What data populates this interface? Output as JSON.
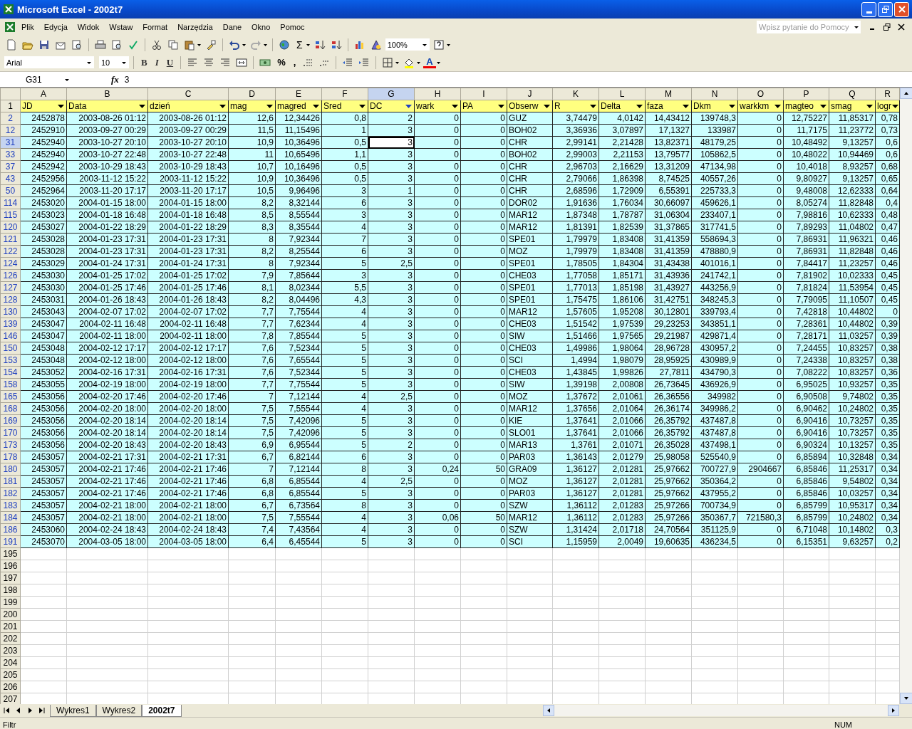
{
  "window": {
    "title": "Microsoft Excel - 2002t7"
  },
  "menu": [
    "Plik",
    "Edycja",
    "Widok",
    "Wstaw",
    "Format",
    "Narzędzia",
    "Dane",
    "Okno",
    "Pomoc"
  ],
  "help_box": {
    "placeholder": "Wpisz pytanie do Pomocy"
  },
  "toolbar": {
    "sum": "Σ",
    "zoom": "100%",
    "font": "Arial",
    "font_size": "10",
    "format_buttons": [
      "B",
      "I",
      "U"
    ],
    "percent": "%",
    "comma": ",",
    "font_color_letter": "A"
  },
  "name_box": "G31",
  "fx": "fx",
  "formula": "3",
  "columns": [
    {
      "letter": "A",
      "selected": false
    },
    {
      "letter": "B",
      "selected": false
    },
    {
      "letter": "C",
      "selected": false
    },
    {
      "letter": "D",
      "selected": false
    },
    {
      "letter": "E",
      "selected": false
    },
    {
      "letter": "F",
      "selected": false
    },
    {
      "letter": "G",
      "selected": true
    },
    {
      "letter": "H",
      "selected": false
    },
    {
      "letter": "I",
      "selected": false
    },
    {
      "letter": "J",
      "selected": false
    },
    {
      "letter": "K",
      "selected": false
    },
    {
      "letter": "L",
      "selected": false
    },
    {
      "letter": "M",
      "selected": false
    },
    {
      "letter": "N",
      "selected": false
    },
    {
      "letter": "O",
      "selected": false
    },
    {
      "letter": "P",
      "selected": false
    },
    {
      "letter": "Q",
      "selected": false
    },
    {
      "letter": "R",
      "selected": false
    }
  ],
  "header_row": {
    "number": "1",
    "cells": [
      {
        "label": "JD",
        "filtered": false
      },
      {
        "label": "Data",
        "filtered": false
      },
      {
        "label": "dzień",
        "filtered": false
      },
      {
        "label": "mag",
        "filtered": false
      },
      {
        "label": "magred",
        "filtered": false
      },
      {
        "label": "Sred",
        "filtered": false
      },
      {
        "label": "DC",
        "filtered": true
      },
      {
        "label": "wark",
        "filtered": false
      },
      {
        "label": "PA",
        "filtered": false
      },
      {
        "label": "Obserw",
        "filtered": false
      },
      {
        "label": "R",
        "filtered": false
      },
      {
        "label": "Delta",
        "filtered": false
      },
      {
        "label": "faza",
        "filtered": false
      },
      {
        "label": "Dkm",
        "filtered": false
      },
      {
        "label": "warkkm",
        "filtered": false
      },
      {
        "label": "magteo",
        "filtered": false
      },
      {
        "label": "smag",
        "filtered": false
      },
      {
        "label": "logr",
        "filtered": false
      }
    ]
  },
  "rows": [
    {
      "number": "2",
      "selected": false,
      "cells": [
        "2452878",
        "2003-08-26 01:12",
        "2003-08-26 01:12",
        "12,6",
        "12,34426",
        "0,8",
        "2",
        "0",
        "0",
        "GUZ",
        "3,74479",
        "4,0142",
        "14,43412",
        "139748,3",
        "0",
        "12,75227",
        "11,85317",
        "0,78"
      ]
    },
    {
      "number": "12",
      "selected": false,
      "cells": [
        "2452910",
        "2003-09-27 00:29",
        "2003-09-27 00:29",
        "11,5",
        "11,15496",
        "1",
        "3",
        "0",
        "0",
        "BOH02",
        "3,36936",
        "3,07897",
        "17,1327",
        "133987",
        "0",
        "11,7175",
        "11,23772",
        "0,73"
      ]
    },
    {
      "number": "31",
      "selected": true,
      "cells": [
        "2452940",
        "2003-10-27 20:10",
        "2003-10-27 20:10",
        "10,9",
        "10,36496",
        "0,5",
        "3",
        "0",
        "0",
        "CHR",
        "2,99141",
        "2,21428",
        "13,82371",
        "48179,25",
        "0",
        "10,48492",
        "9,13257",
        "0,6"
      ]
    },
    {
      "number": "33",
      "selected": false,
      "cells": [
        "2452940",
        "2003-10-27 22:48",
        "2003-10-27 22:48",
        "11",
        "10,65496",
        "1,1",
        "3",
        "0",
        "0",
        "BOH02",
        "2,99003",
        "2,21153",
        "13,79577",
        "105862,5",
        "0",
        "10,48022",
        "10,94469",
        "0,6"
      ]
    },
    {
      "number": "37",
      "selected": false,
      "cells": [
        "2452942",
        "2003-10-29 18:43",
        "2003-10-29 18:43",
        "10,7",
        "10,16496",
        "0,5",
        "3",
        "0",
        "0",
        "CHR",
        "2,96703",
        "2,16629",
        "13,31209",
        "47134,98",
        "0",
        "10,4018",
        "8,93257",
        "0,68"
      ]
    },
    {
      "number": "43",
      "selected": false,
      "cells": [
        "2452956",
        "2003-11-12 15:22",
        "2003-11-12 15:22",
        "10,9",
        "10,36496",
        "0,5",
        "3",
        "0",
        "0",
        "CHR",
        "2,79066",
        "1,86398",
        "8,74525",
        "40557,26",
        "0",
        "9,80927",
        "9,13257",
        "0,65"
      ]
    },
    {
      "number": "50",
      "selected": false,
      "cells": [
        "2452964",
        "2003-11-20 17:17",
        "2003-11-20 17:17",
        "10,5",
        "9,96496",
        "3",
        "1",
        "0",
        "0",
        "CHR",
        "2,68596",
        "1,72909",
        "6,55391",
        "225733,3",
        "0",
        "9,48008",
        "12,62333",
        "0,64"
      ]
    },
    {
      "number": "114",
      "selected": false,
      "cells": [
        "2453020",
        "2004-01-15 18:00",
        "2004-01-15 18:00",
        "8,2",
        "8,32144",
        "6",
        "3",
        "0",
        "0",
        "DOR02",
        "1,91636",
        "1,76034",
        "30,66097",
        "459626,1",
        "0",
        "8,05274",
        "11,82848",
        "0,4"
      ]
    },
    {
      "number": "115",
      "selected": false,
      "cells": [
        "2453023",
        "2004-01-18 16:48",
        "2004-01-18 16:48",
        "8,5",
        "8,55544",
        "3",
        "3",
        "0",
        "0",
        "MAR12",
        "1,87348",
        "1,78787",
        "31,06304",
        "233407,1",
        "0",
        "7,98816",
        "10,62333",
        "0,48"
      ]
    },
    {
      "number": "120",
      "selected": false,
      "cells": [
        "2453027",
        "2004-01-22 18:29",
        "2004-01-22 18:29",
        "8,3",
        "8,35544",
        "4",
        "3",
        "0",
        "0",
        "MAR12",
        "1,81391",
        "1,82539",
        "31,37865",
        "317741,5",
        "0",
        "7,89293",
        "11,04802",
        "0,47"
      ]
    },
    {
      "number": "121",
      "selected": false,
      "cells": [
        "2453028",
        "2004-01-23 17:31",
        "2004-01-23 17:31",
        "8",
        "7,92344",
        "7",
        "3",
        "0",
        "0",
        "SPE01",
        "1,79979",
        "1,83408",
        "31,41359",
        "558694,3",
        "0",
        "7,86931",
        "11,96321",
        "0,46"
      ]
    },
    {
      "number": "122",
      "selected": false,
      "cells": [
        "2453028",
        "2004-01-23 17:31",
        "2004-01-23 17:31",
        "8,2",
        "8,25544",
        "6",
        "3",
        "0",
        "0",
        "MOZ",
        "1,79979",
        "1,83408",
        "31,41359",
        "478880,9",
        "0",
        "7,86931",
        "11,82848",
        "0,46"
      ]
    },
    {
      "number": "124",
      "selected": false,
      "cells": [
        "2453029",
        "2004-01-24 17:31",
        "2004-01-24 17:31",
        "8",
        "7,92344",
        "5",
        "2,5",
        "0",
        "0",
        "SPE01",
        "1,78505",
        "1,84304",
        "31,43438",
        "401016,1",
        "0",
        "7,84417",
        "11,23257",
        "0,46"
      ]
    },
    {
      "number": "126",
      "selected": false,
      "cells": [
        "2453030",
        "2004-01-25 17:02",
        "2004-01-25 17:02",
        "7,9",
        "7,85644",
        "3",
        "3",
        "0",
        "0",
        "CHE03",
        "1,77058",
        "1,85171",
        "31,43936",
        "241742,1",
        "0",
        "7,81902",
        "10,02333",
        "0,45"
      ]
    },
    {
      "number": "127",
      "selected": false,
      "cells": [
        "2453030",
        "2004-01-25 17:46",
        "2004-01-25 17:46",
        "8,1",
        "8,02344",
        "5,5",
        "3",
        "0",
        "0",
        "SPE01",
        "1,77013",
        "1,85198",
        "31,43927",
        "443256,9",
        "0",
        "7,81824",
        "11,53954",
        "0,45"
      ]
    },
    {
      "number": "128",
      "selected": false,
      "cells": [
        "2453031",
        "2004-01-26 18:43",
        "2004-01-26 18:43",
        "8,2",
        "8,04496",
        "4,3",
        "3",
        "0",
        "0",
        "SPE01",
        "1,75475",
        "1,86106",
        "31,42751",
        "348245,3",
        "0",
        "7,79095",
        "11,10507",
        "0,45"
      ]
    },
    {
      "number": "130",
      "selected": false,
      "cells": [
        "2453043",
        "2004-02-07 17:02",
        "2004-02-07 17:02",
        "7,7",
        "7,75544",
        "4",
        "3",
        "0",
        "0",
        "MAR12",
        "1,57605",
        "1,95208",
        "30,12801",
        "339793,4",
        "0",
        "7,42818",
        "10,44802",
        "0"
      ]
    },
    {
      "number": "139",
      "selected": false,
      "cells": [
        "2453047",
        "2004-02-11 16:48",
        "2004-02-11 16:48",
        "7,7",
        "7,62344",
        "4",
        "3",
        "0",
        "0",
        "CHE03",
        "1,51542",
        "1,97539",
        "29,23253",
        "343851,1",
        "0",
        "7,28361",
        "10,44802",
        "0,39"
      ]
    },
    {
      "number": "146",
      "selected": false,
      "cells": [
        "2453047",
        "2004-02-11 18:00",
        "2004-02-11 18:00",
        "7,8",
        "7,85544",
        "5",
        "3",
        "0",
        "0",
        "SIW",
        "1,51466",
        "1,97565",
        "29,21987",
        "429871,4",
        "0",
        "7,28171",
        "11,03257",
        "0,39"
      ]
    },
    {
      "number": "150",
      "selected": false,
      "cells": [
        "2453048",
        "2004-02-12 17:17",
        "2004-02-12 17:17",
        "7,6",
        "7,52344",
        "5",
        "3",
        "0",
        "0",
        "CHE03",
        "1,49986",
        "1,98064",
        "28,96728",
        "430957,2",
        "0",
        "7,24455",
        "10,83257",
        "0,38"
      ]
    },
    {
      "number": "153",
      "selected": false,
      "cells": [
        "2453048",
        "2004-02-12 18:00",
        "2004-02-12 18:00",
        "7,6",
        "7,65544",
        "5",
        "3",
        "0",
        "0",
        "SCI",
        "1,4994",
        "1,98079",
        "28,95925",
        "430989,9",
        "0",
        "7,24338",
        "10,83257",
        "0,38"
      ]
    },
    {
      "number": "154",
      "selected": false,
      "cells": [
        "2453052",
        "2004-02-16 17:31",
        "2004-02-16 17:31",
        "7,6",
        "7,52344",
        "5",
        "3",
        "0",
        "0",
        "CHE03",
        "1,43845",
        "1,99826",
        "27,7811",
        "434790,3",
        "0",
        "7,08222",
        "10,83257",
        "0,36"
      ]
    },
    {
      "number": "158",
      "selected": false,
      "cells": [
        "2453055",
        "2004-02-19 18:00",
        "2004-02-19 18:00",
        "7,7",
        "7,75544",
        "5",
        "3",
        "0",
        "0",
        "SIW",
        "1,39198",
        "2,00808",
        "26,73645",
        "436926,9",
        "0",
        "6,95025",
        "10,93257",
        "0,35"
      ]
    },
    {
      "number": "165",
      "selected": false,
      "cells": [
        "2453056",
        "2004-02-20 17:46",
        "2004-02-20 17:46",
        "7",
        "7,12144",
        "4",
        "2,5",
        "0",
        "0",
        "MOZ",
        "1,37672",
        "2,01061",
        "26,36556",
        "349982",
        "0",
        "6,90508",
        "9,74802",
        "0,35"
      ]
    },
    {
      "number": "168",
      "selected": false,
      "cells": [
        "2453056",
        "2004-02-20 18:00",
        "2004-02-20 18:00",
        "7,5",
        "7,55544",
        "4",
        "3",
        "0",
        "0",
        "MAR12",
        "1,37656",
        "2,01064",
        "26,36174",
        "349986,2",
        "0",
        "6,90462",
        "10,24802",
        "0,35"
      ]
    },
    {
      "number": "169",
      "selected": false,
      "cells": [
        "2453056",
        "2004-02-20 18:14",
        "2004-02-20 18:14",
        "7,5",
        "7,42096",
        "5",
        "3",
        "0",
        "0",
        "KIE",
        "1,37641",
        "2,01066",
        "26,35792",
        "437487,8",
        "0",
        "6,90416",
        "10,73257",
        "0,35"
      ]
    },
    {
      "number": "170",
      "selected": false,
      "cells": [
        "2453056",
        "2004-02-20 18:14",
        "2004-02-20 18:14",
        "7,5",
        "7,42096",
        "5",
        "3",
        "0",
        "0",
        "SLO01",
        "1,37641",
        "2,01066",
        "26,35792",
        "437487,8",
        "0",
        "6,90416",
        "10,73257",
        "0,35"
      ]
    },
    {
      "number": "173",
      "selected": false,
      "cells": [
        "2453056",
        "2004-02-20 18:43",
        "2004-02-20 18:43",
        "6,9",
        "6,95544",
        "5",
        "2",
        "0",
        "0",
        "MAR13",
        "1,3761",
        "2,01071",
        "26,35028",
        "437498,1",
        "0",
        "6,90324",
        "10,13257",
        "0,35"
      ]
    },
    {
      "number": "178",
      "selected": false,
      "cells": [
        "2453057",
        "2004-02-21 17:31",
        "2004-02-21 17:31",
        "6,7",
        "6,82144",
        "6",
        "3",
        "0",
        "0",
        "PAR03",
        "1,36143",
        "2,01279",
        "25,98058",
        "525540,9",
        "0",
        "6,85894",
        "10,32848",
        "0,34"
      ]
    },
    {
      "number": "180",
      "selected": false,
      "cells": [
        "2453057",
        "2004-02-21 17:46",
        "2004-02-21 17:46",
        "7",
        "7,12144",
        "8",
        "3",
        "0,24",
        "50",
        "GRA09",
        "1,36127",
        "2,01281",
        "25,97662",
        "700727,9",
        "2904667",
        "6,85846",
        "11,25317",
        "0,34"
      ]
    },
    {
      "number": "181",
      "selected": false,
      "cells": [
        "2453057",
        "2004-02-21 17:46",
        "2004-02-21 17:46",
        "6,8",
        "6,85544",
        "4",
        "2,5",
        "0",
        "0",
        "MOZ",
        "1,36127",
        "2,01281",
        "25,97662",
        "350364,2",
        "0",
        "6,85846",
        "9,54802",
        "0,34"
      ]
    },
    {
      "number": "182",
      "selected": false,
      "cells": [
        "2453057",
        "2004-02-21 17:46",
        "2004-02-21 17:46",
        "6,8",
        "6,85544",
        "5",
        "3",
        "0",
        "0",
        "PAR03",
        "1,36127",
        "2,01281",
        "25,97662",
        "437955,2",
        "0",
        "6,85846",
        "10,03257",
        "0,34"
      ]
    },
    {
      "number": "183",
      "selected": false,
      "cells": [
        "2453057",
        "2004-02-21 18:00",
        "2004-02-21 18:00",
        "6,7",
        "6,73564",
        "8",
        "3",
        "0",
        "0",
        "SZW",
        "1,36112",
        "2,01283",
        "25,97266",
        "700734,9",
        "0",
        "6,85799",
        "10,95317",
        "0,34"
      ]
    },
    {
      "number": "184",
      "selected": false,
      "cells": [
        "2453057",
        "2004-02-21 18:00",
        "2004-02-21 18:00",
        "7,5",
        "7,55544",
        "4",
        "3",
        "0,06",
        "50",
        "MAR12",
        "1,36112",
        "2,01283",
        "25,97266",
        "350367,7",
        "721580,3",
        "6,85799",
        "10,24802",
        "0,34"
      ]
    },
    {
      "number": "186",
      "selected": false,
      "cells": [
        "2453060",
        "2004-02-24 18:43",
        "2004-02-24 18:43",
        "7,4",
        "7,43564",
        "4",
        "3",
        "0",
        "0",
        "SZW",
        "1,31424",
        "2,01718",
        "24,70564",
        "351125,9",
        "0",
        "6,71048",
        "10,14802",
        "0,3"
      ]
    },
    {
      "number": "191",
      "selected": false,
      "cells": [
        "2453070",
        "2004-03-05 18:00",
        "2004-03-05 18:00",
        "6,4",
        "6,45544",
        "5",
        "3",
        "0",
        "0",
        "SCI",
        "1,15959",
        "2,0049",
        "19,60635",
        "436234,5",
        "0",
        "6,15351",
        "9,63257",
        "0,2"
      ]
    }
  ],
  "empty_rows": [
    "195",
    "196",
    "197",
    "198",
    "199",
    "200",
    "201",
    "202",
    "203",
    "204",
    "205",
    "206",
    "207"
  ],
  "sheet_tabs": [
    {
      "label": "Wykres1",
      "selected": false
    },
    {
      "label": "Wykres2",
      "selected": false
    },
    {
      "label": "2002t7",
      "selected": true
    }
  ],
  "status_bar": {
    "mode": "Filtr",
    "num": "NUM"
  }
}
